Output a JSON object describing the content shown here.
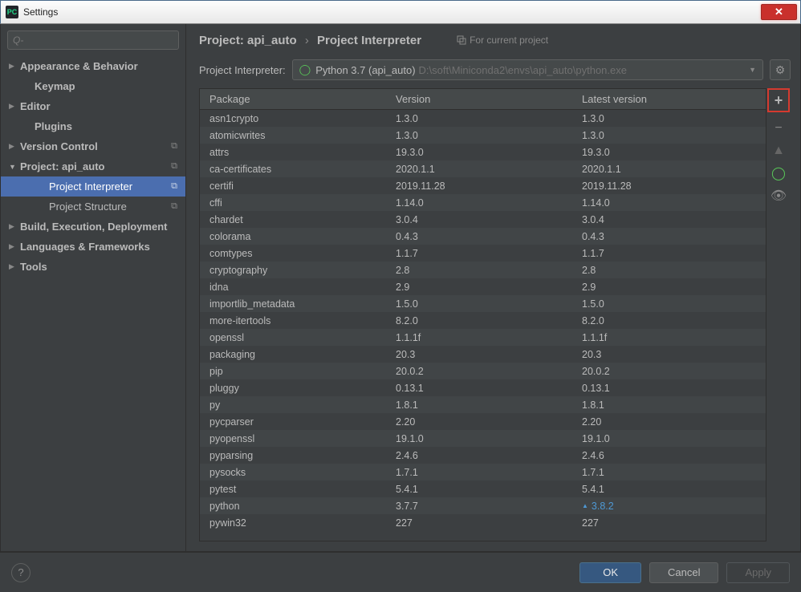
{
  "window": {
    "title": "Settings"
  },
  "search": {
    "placeholder": "Q-"
  },
  "tree": [
    {
      "label": "Appearance & Behavior",
      "level": 0,
      "bold": true,
      "arrow": "▶"
    },
    {
      "label": "Keymap",
      "level": 1,
      "bold": true
    },
    {
      "label": "Editor",
      "level": 0,
      "bold": true,
      "arrow": "▶"
    },
    {
      "label": "Plugins",
      "level": 1,
      "bold": true
    },
    {
      "label": "Version Control",
      "level": 0,
      "bold": true,
      "arrow": "▶",
      "copy": true
    },
    {
      "label": "Project: api_auto",
      "level": 0,
      "bold": true,
      "arrow": "▼",
      "copy": true,
      "expanded": true
    },
    {
      "label": "Project Interpreter",
      "level": 2,
      "selected": true,
      "copy": true
    },
    {
      "label": "Project Structure",
      "level": 2,
      "copy": true
    },
    {
      "label": "Build, Execution, Deployment",
      "level": 0,
      "bold": true,
      "arrow": "▶"
    },
    {
      "label": "Languages & Frameworks",
      "level": 0,
      "bold": true,
      "arrow": "▶"
    },
    {
      "label": "Tools",
      "level": 0,
      "bold": true,
      "arrow": "▶"
    }
  ],
  "breadcrumb": {
    "part1": "Project: api_auto",
    "sep": "›",
    "part2": "Project Interpreter"
  },
  "hint": "For current project",
  "interpreter": {
    "label": "Project Interpreter:",
    "name": "Python 3.7 (api_auto)",
    "path": "D:\\soft\\Miniconda2\\envs\\api_auto\\python.exe"
  },
  "table": {
    "headers": {
      "pkg": "Package",
      "ver": "Version",
      "lat": "Latest version"
    },
    "rows": [
      {
        "p": "asn1crypto",
        "v": "1.3.0",
        "l": "1.3.0"
      },
      {
        "p": "atomicwrites",
        "v": "1.3.0",
        "l": "1.3.0"
      },
      {
        "p": "attrs",
        "v": "19.3.0",
        "l": "19.3.0"
      },
      {
        "p": "ca-certificates",
        "v": "2020.1.1",
        "l": "2020.1.1"
      },
      {
        "p": "certifi",
        "v": "2019.11.28",
        "l": "2019.11.28"
      },
      {
        "p": "cffi",
        "v": "1.14.0",
        "l": "1.14.0"
      },
      {
        "p": "chardet",
        "v": "3.0.4",
        "l": "3.0.4"
      },
      {
        "p": "colorama",
        "v": "0.4.3",
        "l": "0.4.3"
      },
      {
        "p": "comtypes",
        "v": "1.1.7",
        "l": "1.1.7"
      },
      {
        "p": "cryptography",
        "v": "2.8",
        "l": "2.8"
      },
      {
        "p": "idna",
        "v": "2.9",
        "l": "2.9"
      },
      {
        "p": "importlib_metadata",
        "v": "1.5.0",
        "l": "1.5.0"
      },
      {
        "p": "more-itertools",
        "v": "8.2.0",
        "l": "8.2.0"
      },
      {
        "p": "openssl",
        "v": "1.1.1f",
        "l": "1.1.1f"
      },
      {
        "p": "packaging",
        "v": "20.3",
        "l": "20.3"
      },
      {
        "p": "pip",
        "v": "20.0.2",
        "l": "20.0.2"
      },
      {
        "p": "pluggy",
        "v": "0.13.1",
        "l": "0.13.1"
      },
      {
        "p": "py",
        "v": "1.8.1",
        "l": "1.8.1"
      },
      {
        "p": "pycparser",
        "v": "2.20",
        "l": "2.20"
      },
      {
        "p": "pyopenssl",
        "v": "19.1.0",
        "l": "19.1.0"
      },
      {
        "p": "pyparsing",
        "v": "2.4.6",
        "l": "2.4.6"
      },
      {
        "p": "pysocks",
        "v": "1.7.1",
        "l": "1.7.1"
      },
      {
        "p": "pytest",
        "v": "5.4.1",
        "l": "5.4.1"
      },
      {
        "p": "python",
        "v": "3.7.7",
        "l": "3.8.2",
        "upg": true
      },
      {
        "p": "pywin32",
        "v": "227",
        "l": "227"
      }
    ]
  },
  "footer": {
    "ok": "OK",
    "cancel": "Cancel",
    "apply": "Apply"
  }
}
